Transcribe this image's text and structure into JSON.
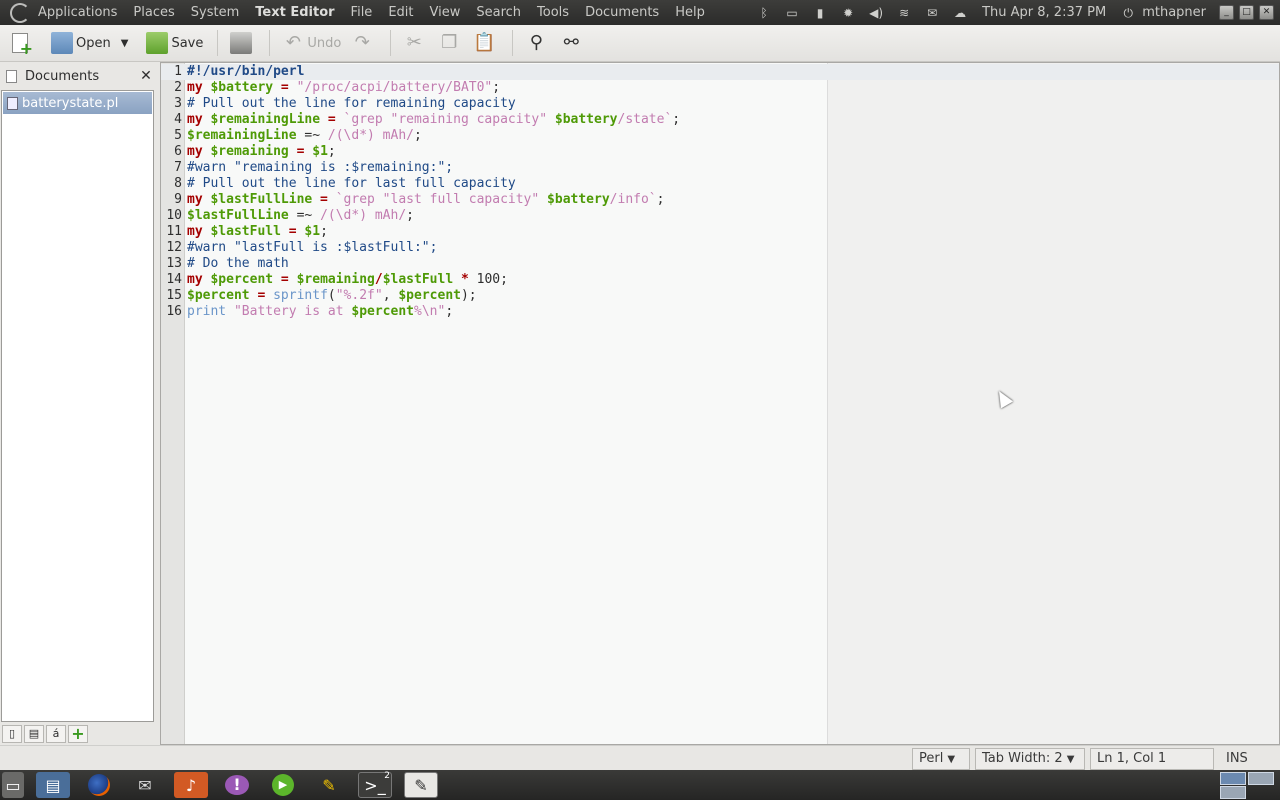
{
  "top_panel": {
    "menus": [
      "Applications",
      "Places",
      "System",
      "Text Editor",
      "File",
      "Edit",
      "View",
      "Search",
      "Tools",
      "Documents",
      "Help"
    ],
    "active_app": "Text Editor",
    "clock": "Thu Apr  8,  2:37 PM",
    "user": "mthapner"
  },
  "toolbar": {
    "open_label": "Open",
    "save_label": "Save",
    "undo_label": "Undo"
  },
  "side_panel": {
    "title": "Documents",
    "close_glyph": "✕",
    "documents": [
      "batterystate.pl"
    ]
  },
  "editor": {
    "lines": [
      {
        "n": "1",
        "tokens": [
          {
            "t": "#!/usr/bin/perl",
            "c": "shebang"
          }
        ]
      },
      {
        "n": "2",
        "tokens": [
          {
            "t": "my ",
            "c": "kw"
          },
          {
            "t": "$battery",
            "c": "var"
          },
          {
            "t": " = ",
            "c": "op"
          },
          {
            "t": "\"/proc/acpi/battery/BAT0\"",
            "c": "str"
          },
          {
            "t": ";",
            "c": "plain"
          }
        ]
      },
      {
        "n": "3",
        "tokens": [
          {
            "t": "# Pull out the line for remaining capacity",
            "c": "cmt"
          }
        ]
      },
      {
        "n": "4",
        "tokens": [
          {
            "t": "my ",
            "c": "kw"
          },
          {
            "t": "$remainingLine",
            "c": "var"
          },
          {
            "t": " = ",
            "c": "op"
          },
          {
            "t": "`grep \"remaining capacity\" ",
            "c": "str"
          },
          {
            "t": "$battery",
            "c": "var"
          },
          {
            "t": "/state`",
            "c": "str"
          },
          {
            "t": ";",
            "c": "plain"
          }
        ]
      },
      {
        "n": "5",
        "tokens": [
          {
            "t": "$remainingLine",
            "c": "var"
          },
          {
            "t": " =~ ",
            "c": "plain"
          },
          {
            "t": "/(\\d*) mAh/",
            "c": "str"
          },
          {
            "t": ";",
            "c": "plain"
          }
        ]
      },
      {
        "n": "6",
        "tokens": [
          {
            "t": "my ",
            "c": "kw"
          },
          {
            "t": "$remaining",
            "c": "var"
          },
          {
            "t": " = ",
            "c": "op"
          },
          {
            "t": "$1",
            "c": "var"
          },
          {
            "t": ";",
            "c": "plain"
          }
        ]
      },
      {
        "n": "7",
        "tokens": [
          {
            "t": "#warn \"remaining is :$remaining:\";",
            "c": "cmt"
          }
        ]
      },
      {
        "n": "8",
        "tokens": [
          {
            "t": "# Pull out the line for last full capacity",
            "c": "cmt"
          }
        ]
      },
      {
        "n": "9",
        "tokens": [
          {
            "t": "my ",
            "c": "kw"
          },
          {
            "t": "$lastFullLine",
            "c": "var"
          },
          {
            "t": " = ",
            "c": "op"
          },
          {
            "t": "`grep \"last full capacity\" ",
            "c": "str"
          },
          {
            "t": "$battery",
            "c": "var"
          },
          {
            "t": "/info`",
            "c": "str"
          },
          {
            "t": ";",
            "c": "plain"
          }
        ]
      },
      {
        "n": "10",
        "tokens": [
          {
            "t": "$lastFullLine",
            "c": "var"
          },
          {
            "t": " =~ ",
            "c": "plain"
          },
          {
            "t": "/(\\d*) mAh/",
            "c": "str"
          },
          {
            "t": ";",
            "c": "plain"
          }
        ]
      },
      {
        "n": "11",
        "tokens": [
          {
            "t": "my ",
            "c": "kw"
          },
          {
            "t": "$lastFull",
            "c": "var"
          },
          {
            "t": " = ",
            "c": "op"
          },
          {
            "t": "$1",
            "c": "var"
          },
          {
            "t": ";",
            "c": "plain"
          }
        ]
      },
      {
        "n": "12",
        "tokens": [
          {
            "t": "#warn \"lastFull is :$lastFull:\";",
            "c": "cmt"
          }
        ]
      },
      {
        "n": "13",
        "tokens": [
          {
            "t": "# Do the math",
            "c": "cmt"
          }
        ]
      },
      {
        "n": "14",
        "tokens": [
          {
            "t": "my ",
            "c": "kw"
          },
          {
            "t": "$percent",
            "c": "var"
          },
          {
            "t": " = ",
            "c": "op"
          },
          {
            "t": "$remaining",
            "c": "var"
          },
          {
            "t": "/",
            "c": "op"
          },
          {
            "t": "$lastFull",
            "c": "var"
          },
          {
            "t": " * ",
            "c": "op"
          },
          {
            "t": "100",
            "c": "plain"
          },
          {
            "t": ";",
            "c": "plain"
          }
        ]
      },
      {
        "n": "15",
        "tokens": [
          {
            "t": "$percent",
            "c": "var"
          },
          {
            "t": " = ",
            "c": "op"
          },
          {
            "t": "sprintf",
            "c": "fn"
          },
          {
            "t": "(",
            "c": "plain"
          },
          {
            "t": "\"%.2f\"",
            "c": "str"
          },
          {
            "t": ", ",
            "c": "plain"
          },
          {
            "t": "$percent",
            "c": "var"
          },
          {
            "t": ");",
            "c": "plain"
          }
        ]
      },
      {
        "n": "16",
        "tokens": [
          {
            "t": "print ",
            "c": "fn"
          },
          {
            "t": "\"Battery is at ",
            "c": "str"
          },
          {
            "t": "$percent",
            "c": "var"
          },
          {
            "t": "%\\n\"",
            "c": "str"
          },
          {
            "t": ";",
            "c": "plain"
          }
        ]
      }
    ]
  },
  "status_bar": {
    "language": "Perl",
    "tab_width": "Tab Width:  2",
    "position": "Ln 1, Col 1",
    "mode": "INS"
  },
  "taskbar": {
    "terminal_badge": "2"
  },
  "colors": {
    "keyword": "#a40000",
    "variable": "#4e9a06",
    "string": "#c27cb0",
    "comment": "#204a87",
    "selection": "#8aa2c2"
  }
}
